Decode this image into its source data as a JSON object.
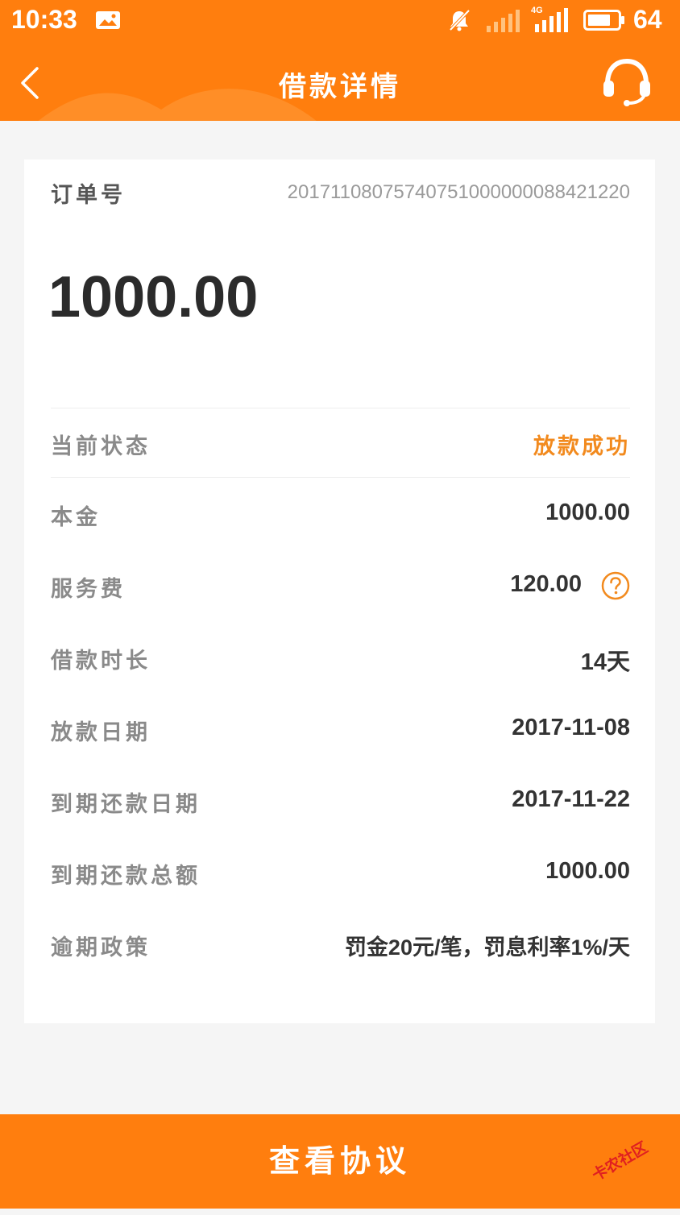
{
  "status_bar": {
    "time": "10:33",
    "network_type": "4G",
    "battery": "64"
  },
  "header": {
    "title": "借款详情",
    "back_icon": "chevron-left-icon",
    "support_icon": "headset-icon"
  },
  "colors": {
    "brand_orange": "#ff7e0e",
    "status_orange": "#f28a1e"
  },
  "order": {
    "label": "订单号",
    "number": "20171108075740751000000088421220"
  },
  "amount": "1000.00",
  "status": {
    "label": "当前状态",
    "value": "放款成功"
  },
  "details": [
    {
      "label": "本金",
      "value": "1000.00"
    },
    {
      "label": "服务费",
      "value": "120.00"
    },
    {
      "label": "借款时长",
      "value": "14天"
    },
    {
      "label": "放款日期",
      "value": "2017-11-08"
    },
    {
      "label": "到期还款日期",
      "value": "2017-11-22"
    },
    {
      "label": "到期还款总额",
      "value": "1000.00"
    },
    {
      "label": "逾期政策",
      "value": "罚金20元/笔，罚息利率1%/天"
    }
  ],
  "bottom_button": "查看协议",
  "watermark": "卡农社区"
}
